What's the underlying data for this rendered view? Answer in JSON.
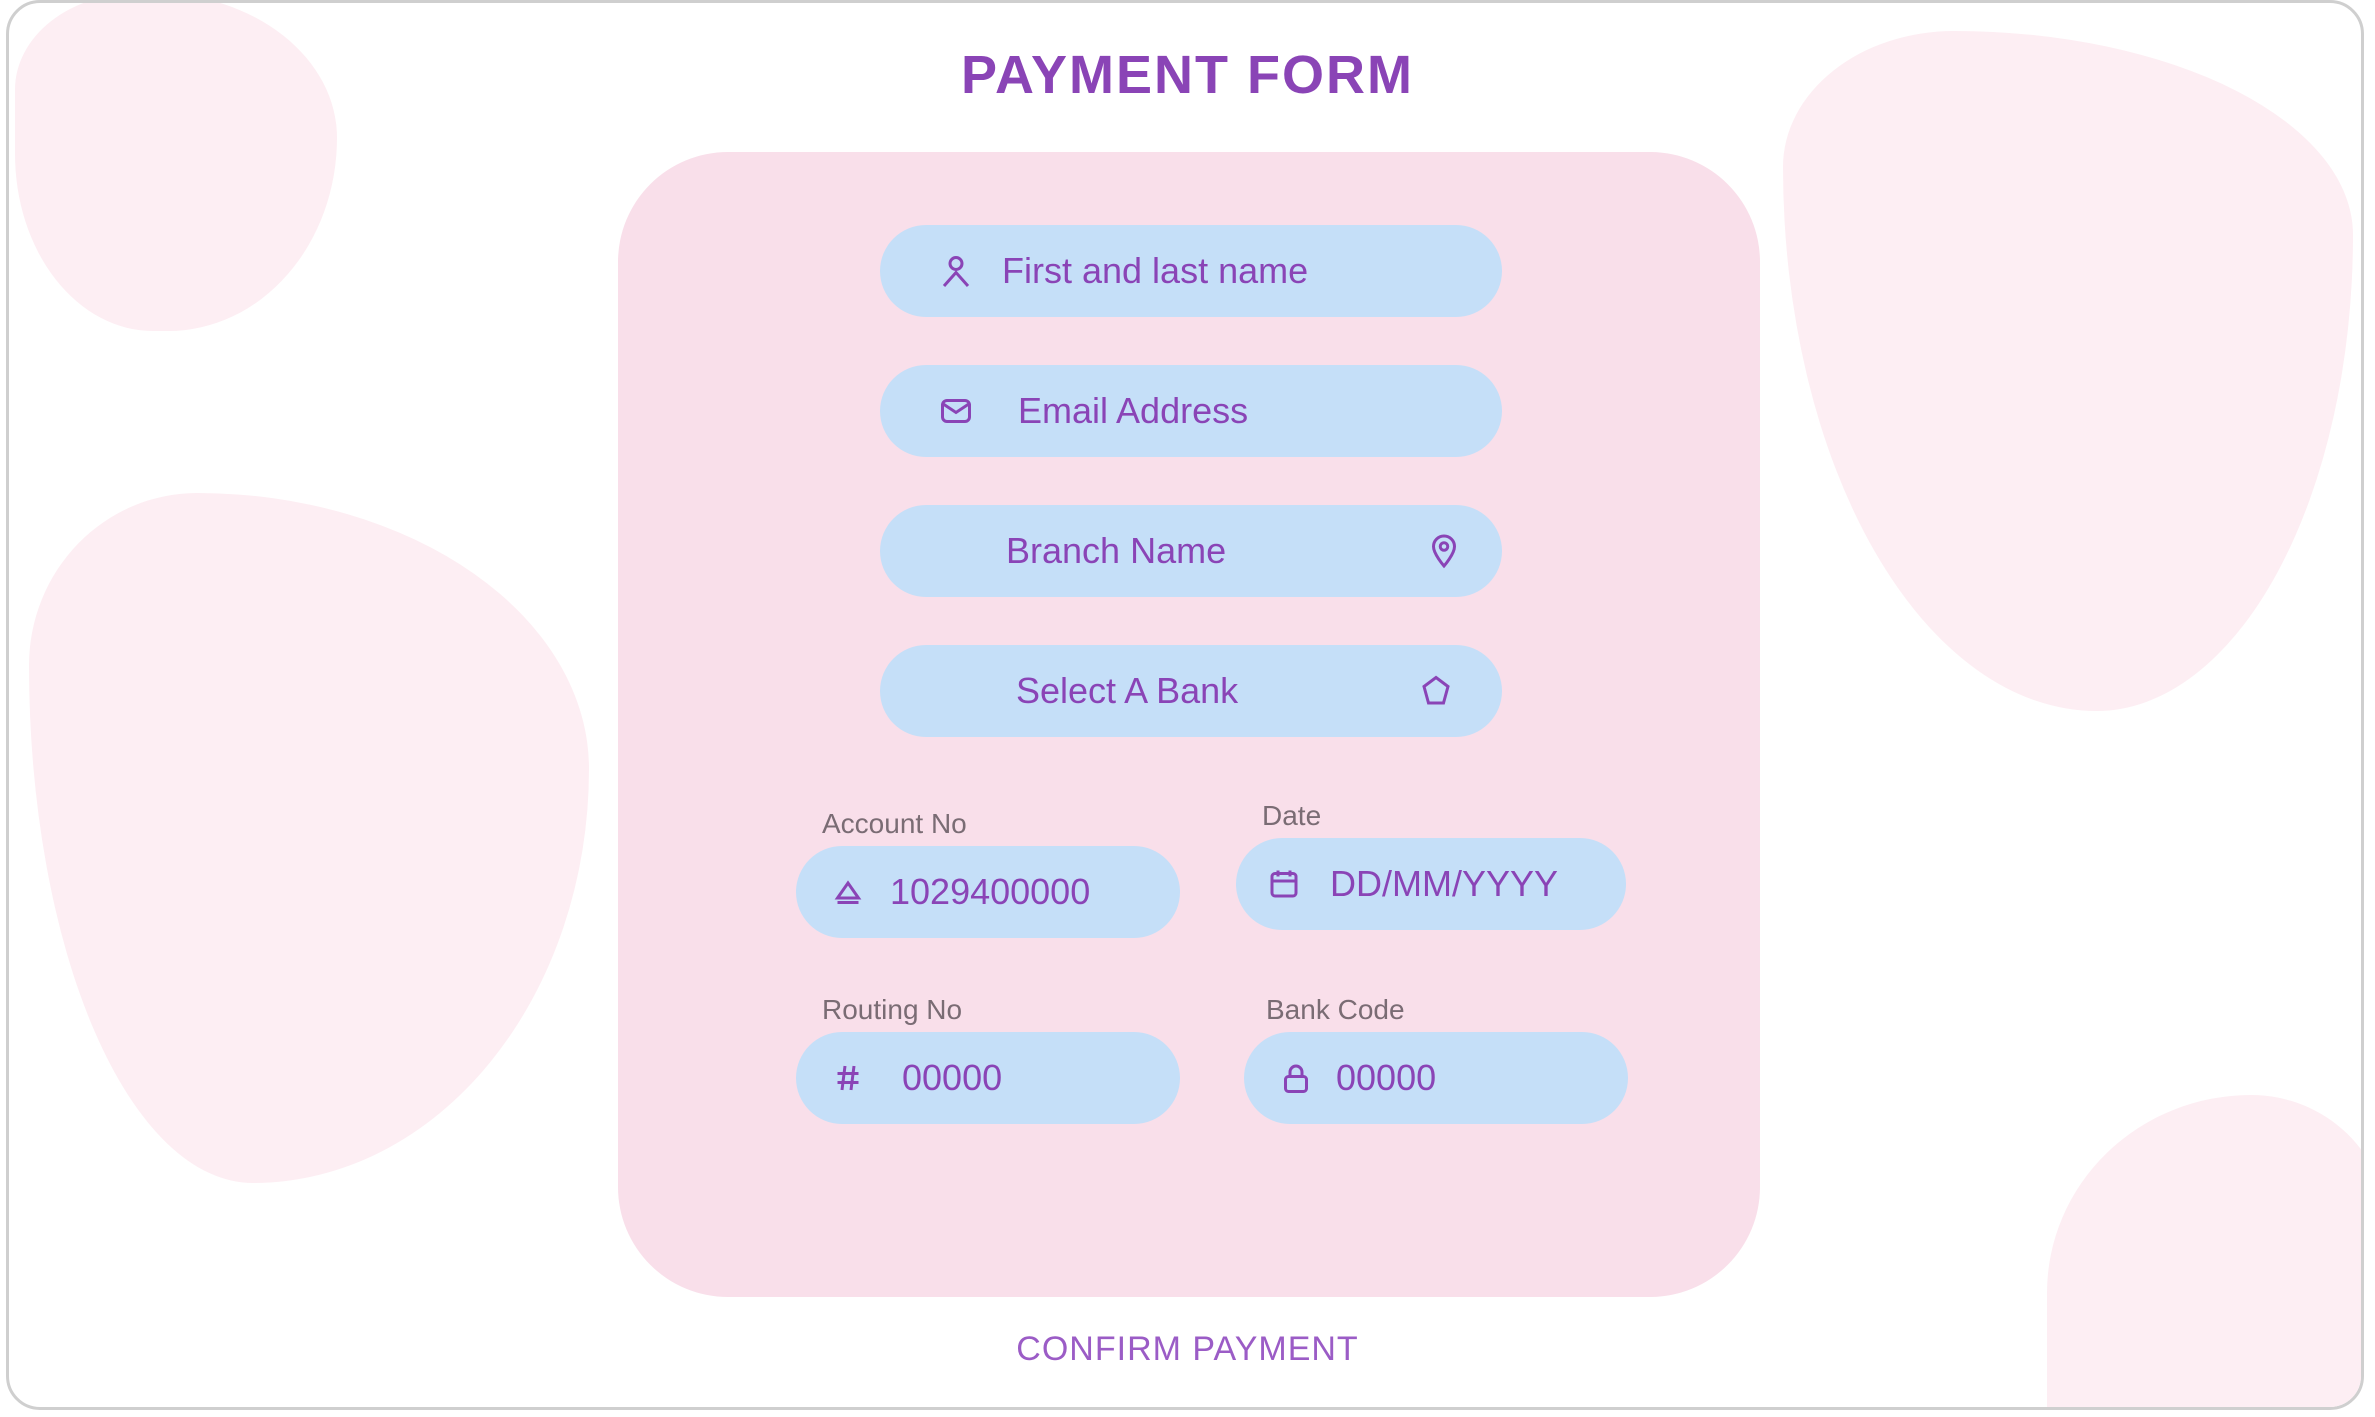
{
  "form": {
    "title": "PAYMENT FORM",
    "name_placeholder": "First and last name",
    "email_placeholder": "Email Address",
    "branch_placeholder": "Branch Name",
    "bank_placeholder": "Select A Bank",
    "account": {
      "label": "Account No",
      "placeholder": "1029400000"
    },
    "date": {
      "label": "Date",
      "placeholder": "DD/MM/YYYY"
    },
    "routing": {
      "label": "Routing No",
      "placeholder": "00000"
    },
    "bank_code": {
      "label": "Bank Code",
      "placeholder": "00000"
    },
    "confirm_label": "CONFIRM PAYMENT"
  },
  "colors": {
    "accent": "#8a44b6",
    "card_bg": "#f9dfea",
    "input_bg": "#c5dff8",
    "blob": "#fdeef3"
  },
  "icons": {
    "name": "user-icon",
    "email": "mail-icon",
    "branch": "location-icon",
    "bank": "bank-icon",
    "account": "card-icon",
    "date": "calendar-icon",
    "routing": "hash-icon",
    "bank_code": "lock-icon"
  }
}
